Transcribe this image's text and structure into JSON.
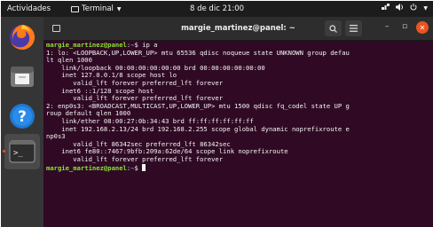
{
  "topbar": {
    "activities": "Actividades",
    "app_menu": "Terminal",
    "clock": "8 de dic  21:00"
  },
  "dock": {
    "items": [
      "firefox",
      "files",
      "help",
      "terminal"
    ]
  },
  "window": {
    "title": "margie_martinez@panel: ~"
  },
  "terminal": {
    "prompt_user": "margie_martinez@panel",
    "prompt_path": "~",
    "lines": [
      {
        "type": "prompt",
        "cmd": "ip a"
      },
      {
        "type": "text",
        "text": "1: lo: <LOOPBACK,UP,LOWER_UP> mtu 65536 qdisc noqueue state UNKNOWN group defau"
      },
      {
        "type": "text",
        "text": "lt qlen 1000"
      },
      {
        "type": "text",
        "text": "    link/loopback 00:00:00:00:00:00 brd 00:00:00:00:00:00"
      },
      {
        "type": "text",
        "text": "    inet 127.0.0.1/8 scope host lo"
      },
      {
        "type": "text",
        "text": "       valid_lft forever preferred_lft forever"
      },
      {
        "type": "text",
        "text": "    inet6 ::1/128 scope host"
      },
      {
        "type": "text",
        "text": "       valid_lft forever preferred_lft forever"
      },
      {
        "type": "text",
        "text": "2: enp0s3: <BROADCAST,MULTICAST,UP,LOWER_UP> mtu 1500 qdisc fq_codel state UP g"
      },
      {
        "type": "text",
        "text": "roup default qlen 1000"
      },
      {
        "type": "text",
        "text": "    link/ether 08:00:27:0b:34:43 brd ff:ff:ff:ff:ff:ff"
      },
      {
        "type": "text",
        "text": "    inet 192.168.2.13/24 brd 192.168.2.255 scope global dynamic noprefixroute e"
      },
      {
        "type": "text",
        "text": "np0s3"
      },
      {
        "type": "text",
        "text": "       valid_lft 86342sec preferred_lft 86342sec"
      },
      {
        "type": "text",
        "text": "    inet6 fe80::7467:9bfb:209a:62de/64 scope link noprefixroute"
      },
      {
        "type": "text",
        "text": "       valid_lft forever preferred_lft forever"
      },
      {
        "type": "prompt",
        "cmd": "",
        "cursor": true
      }
    ]
  }
}
